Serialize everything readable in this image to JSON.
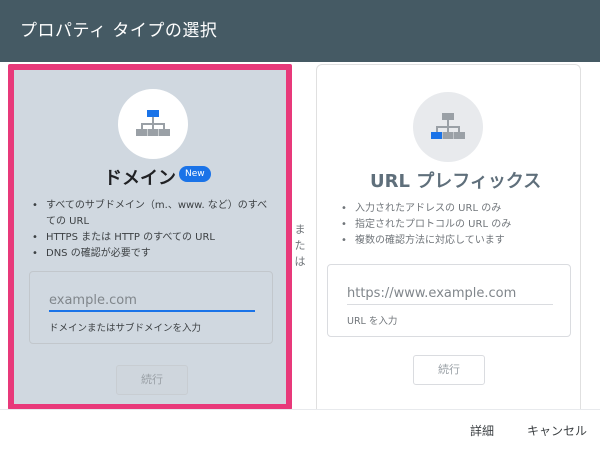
{
  "dialog": {
    "title": "プロパティ タイプの選択"
  },
  "domain_option": {
    "icon": "sitemap-icon",
    "title": "ドメイン",
    "badge": "New",
    "features": [
      "すべてのサブドメイン（m.、www. など）のすべての URL",
      "HTTPS または HTTP のすべての URL",
      "DNS の確認が必要です"
    ],
    "input_placeholder": "example.com",
    "input_value": "",
    "help_text": "ドメインまたはサブドメインを入力",
    "continue_label": "続行"
  },
  "or_label": "または",
  "url_option": {
    "icon": "sitemap-icon",
    "title": "URL プレフィックス",
    "features": [
      "入力されたアドレスの URL のみ",
      "指定されたプロトコルの URL のみ",
      "複数の確認方法に対応しています"
    ],
    "input_placeholder": "https://www.example.com",
    "input_value": "",
    "help_text": "URL を入力",
    "continue_label": "続行"
  },
  "footer": {
    "details_label": "詳細",
    "cancel_label": "キャンセル"
  },
  "colors": {
    "header_bg": "#455a64",
    "selection_border": "#e8397a",
    "accent": "#1a73e8"
  }
}
